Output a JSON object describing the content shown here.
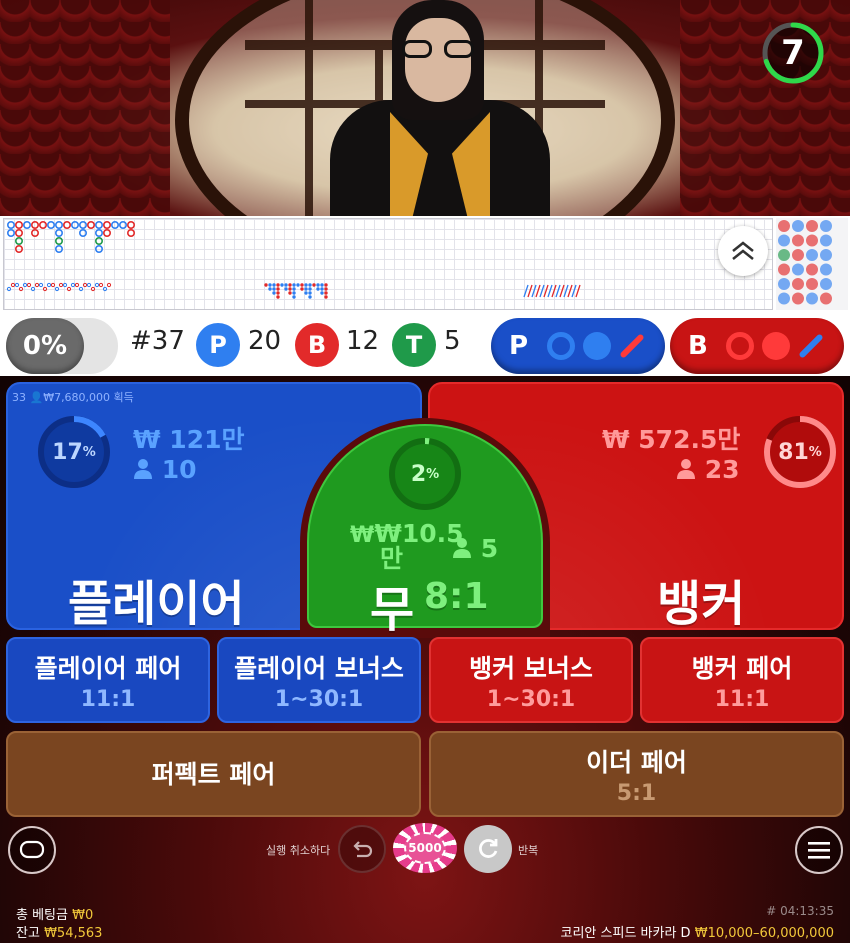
{
  "timer": {
    "seconds": "7",
    "fraction_remaining": 0.7,
    "color": "#2fd84a"
  },
  "roadmap": {
    "expand_icon": "chevron-up-icon"
  },
  "stats": {
    "percent_toggle": "0%",
    "round": "#37",
    "player": {
      "letter": "P",
      "count": "20",
      "color": "#2f7ff0"
    },
    "banker": {
      "letter": "B",
      "count": "12",
      "color": "#e22a2a"
    },
    "tie": {
      "letter": "T",
      "count": "5",
      "color": "#1f9a4a"
    },
    "player_predict": {
      "letter": "P",
      "color": "#1a4fc8"
    },
    "banker_predict": {
      "letter": "B",
      "color": "#c81414"
    }
  },
  "bets": {
    "top_note": "33 👤₩7,680,000 획득",
    "player": {
      "label": "플레이어",
      "percent": "17",
      "amount": "₩ 121만",
      "bettors": "10",
      "share": 0.17
    },
    "tie": {
      "label": "무",
      "odds": "8:1",
      "percent": "2",
      "amount_line1": "₩10.5",
      "amount_line2": "만",
      "bettors": "5",
      "share": 0.02
    },
    "banker": {
      "label": "뱅커",
      "percent": "81",
      "amount": "₩ 572.5만",
      "bettors": "23",
      "share": 0.81
    },
    "side": [
      {
        "name": "플레이어 페어",
        "odds": "11:1"
      },
      {
        "name": "플레이어 보너스",
        "odds": "1~30:1"
      },
      {
        "name": "뱅커 보너스",
        "odds": "1~30:1"
      },
      {
        "name": "뱅커 페어",
        "odds": "11:1"
      }
    ],
    "perfect_pair": {
      "name": "퍼펙트 페어",
      "odds": ""
    },
    "either_pair": {
      "name": "이더 페어",
      "odds": "5:1"
    }
  },
  "controls": {
    "chat_icon": "chat-bubble-icon",
    "undo_label": "실행 취소하다",
    "undo_icon": "undo-icon",
    "chip_value": "5000",
    "repeat_icon": "repeat-icon",
    "repeat_label": "반복",
    "menu_icon": "menu-icon"
  },
  "footer": {
    "total_bet_label": "총 베팅금",
    "total_bet_value": "₩0",
    "balance_label": "잔고",
    "balance_value": "₩54,563",
    "game_id": "# 04:13:35",
    "table_name": "코리안 스피드 바카라 D",
    "limits": "₩10,000–60,000,000"
  }
}
